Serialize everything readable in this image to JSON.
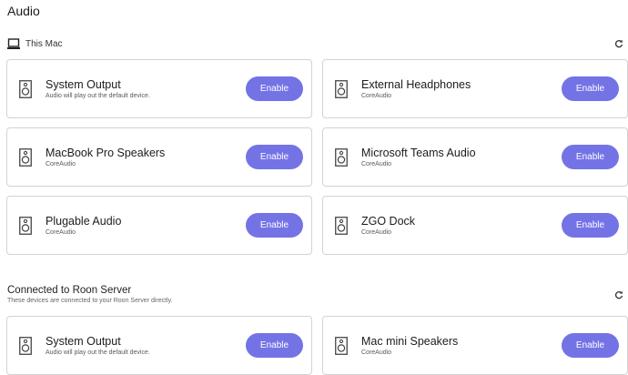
{
  "header": {
    "title": "Audio"
  },
  "this_mac": {
    "label": "This Mac",
    "devices": [
      {
        "name": "System Output",
        "desc": "Audio will play out the default device.",
        "button": "Enable"
      },
      {
        "name": "External Headphones",
        "desc": "CoreAudio",
        "button": "Enable"
      },
      {
        "name": "MacBook Pro Speakers",
        "desc": "CoreAudio",
        "button": "Enable"
      },
      {
        "name": "Microsoft Teams Audio",
        "desc": "CoreAudio",
        "button": "Enable"
      },
      {
        "name": "Plugable Audio",
        "desc": "CoreAudio",
        "button": "Enable"
      },
      {
        "name": "ZGO Dock",
        "desc": "CoreAudio",
        "button": "Enable"
      }
    ]
  },
  "connected": {
    "title": "Connected to Roon Server",
    "subtitle": "These devices are connected to your Roon Server directly.",
    "devices": [
      {
        "name": "System Output",
        "desc": "Audio will play out the default device.",
        "button": "Enable"
      },
      {
        "name": "Mac mini Speakers",
        "desc": "CoreAudio",
        "button": "Enable"
      }
    ]
  },
  "colors": {
    "accent": "#7473e6",
    "border": "#d3d3d3"
  },
  "icons": {
    "computer": "laptop-icon",
    "refresh": "refresh-icon",
    "device": "speaker-icon"
  }
}
